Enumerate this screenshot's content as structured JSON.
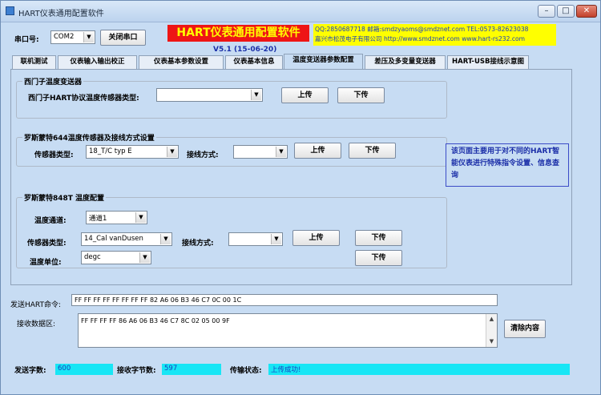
{
  "window": {
    "title": "HART仪表通用配置软件",
    "controls": {
      "minimize": "–",
      "maximize": "□",
      "close": "✕"
    }
  },
  "toolbar": {
    "port_label": "串口号:",
    "port_value": "COM2",
    "close_port_label": "关闭串口"
  },
  "banner": {
    "title": "HART仪表通用配置软件",
    "contact_line1": "QQ:2850687718   邮箱:smdzyaoms@smdznet.com TEL:0573-82623038",
    "contact_line2": "嘉兴市松茂电子有限公司 http://www.smdznet.com  www.hart-rs232.com",
    "version": "V5.1 (15-06-20)"
  },
  "tabs": [
    {
      "label": "联机测试"
    },
    {
      "label": "仪表输入输出校正"
    },
    {
      "label": "仪表基本参数设置"
    },
    {
      "label": "仪表基本信息"
    },
    {
      "label": "温度变送器参数配置"
    },
    {
      "label": "差压及多变量变送器"
    },
    {
      "label": "HART-USB接线示意图"
    }
  ],
  "siemens": {
    "title": "西门子温度变送器",
    "sensor_label": "西门子HART协议温度传感器类型:",
    "sensor_value": "",
    "upload": "上传",
    "download": "下传"
  },
  "rosemount644": {
    "title": "罗斯蒙特644温度传感器及接线方式设置",
    "sensor_label": "传感器类型:",
    "sensor_value": "18_T/C typ E",
    "wiring_label": "接线方式:",
    "wiring_value": "",
    "upload": "上传",
    "download": "下传"
  },
  "rosemount848": {
    "title": "罗斯蒙特848T 温度配置",
    "channel_label": "温度通道:",
    "channel_value": "通道1",
    "sensor_label": "传感器类型:",
    "sensor_value": "14_Cal vanDusen",
    "wiring_label": "接线方式:",
    "wiring_value": "",
    "unit_label": "温度单位:",
    "unit_value": "degc",
    "upload": "上传",
    "download1": "下传",
    "download2": "下传"
  },
  "note": "该页面主要用于对不同的HART智能仪表进行特殊指令设置、信息查询",
  "comm": {
    "send_label": "发送HART命令:",
    "send_value": "FF FF FF FF FF FF FF FF 82 A6 06 B3 46 C7 0C 00 1C",
    "recv_label": "接收数据区:",
    "recv_value": "FF FF FF FF 86 A6 06 B3 46 C7 8C 02 05 00 9F",
    "clear_label": "清除内容"
  },
  "status": {
    "sent_label": "发送字数:",
    "sent_value": "600",
    "recv_label": "接收字节数:",
    "recv_value": "597",
    "state_label": "传输状态:",
    "state_value": "上传成功!"
  }
}
